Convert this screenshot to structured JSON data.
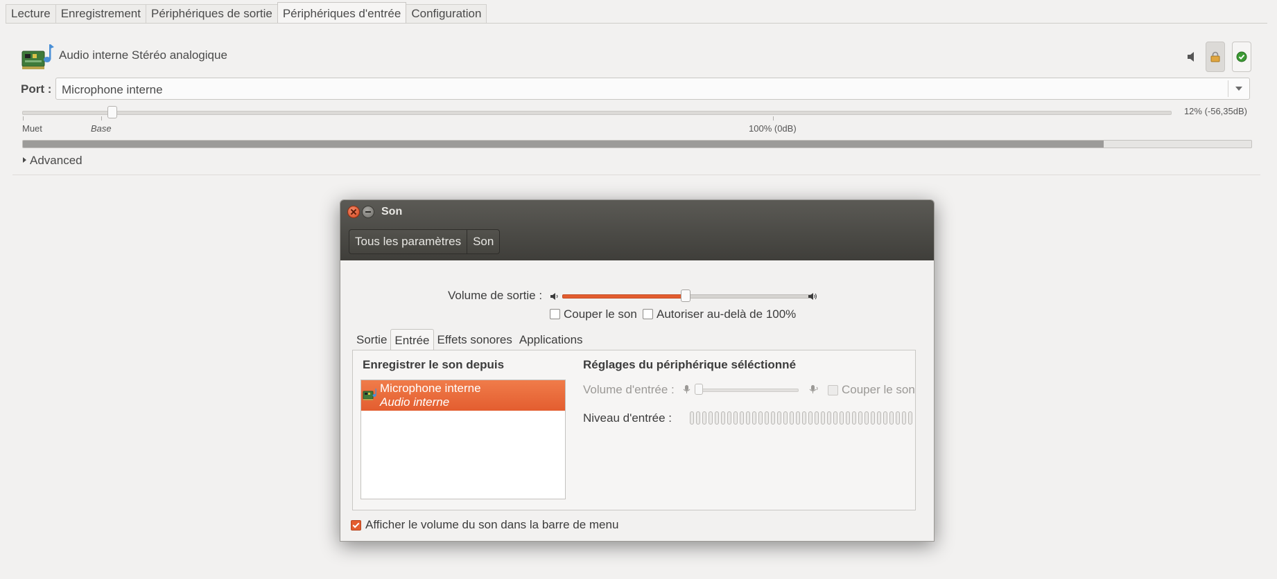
{
  "pavucontrol": {
    "tabs": [
      {
        "label": "Lecture"
      },
      {
        "label": "Enregistrement"
      },
      {
        "label": "Périphériques de sortie"
      },
      {
        "label": "Périphériques d'entrée",
        "active": true
      },
      {
        "label": "Configuration"
      }
    ],
    "device_name": "Audio interne Stéréo analogique",
    "port_label": "Port :",
    "port_value": "Microphone interne",
    "volume_percent": 12,
    "volume_readout": "12% (-56,35dB)",
    "marks": {
      "mute": "Muet",
      "base": "Base",
      "full": "100% (0dB)"
    },
    "level_fraction": 0.88,
    "advanced_label": "Advanced",
    "icons": [
      "sound-card-icon",
      "speaker-mute-icon",
      "lock-icon",
      "check-default-icon"
    ]
  },
  "dialog": {
    "title": "Son",
    "breadcrumbs": [
      "Tous les paramètres",
      "Son"
    ],
    "output_volume_label": "Volume de sortie :",
    "output_volume_fraction": 0.5,
    "mute_label": "Couper le son",
    "mute_checked": false,
    "overamp_label": "Autoriser au-delà de 100%",
    "overamp_checked": false,
    "tabs": [
      {
        "label": "Sortie"
      },
      {
        "label": "Entrée",
        "active": true
      },
      {
        "label": "Effets sonores"
      },
      {
        "label": "Applications"
      }
    ],
    "record_from_heading": "Enregistrer le son depuis",
    "devices": [
      {
        "name": "Microphone interne",
        "sub": "Audio interne",
        "selected": true
      }
    ],
    "settings_heading": "Réglages du périphérique séléctionné",
    "input_volume_label": "Volume d'entrée :",
    "input_mute_label": "Couper le son",
    "input_level_label": "Niveau d'entrée :",
    "show_volume_label": "Afficher le volume du son dans la barre de menu",
    "show_volume_checked": true
  },
  "colors": {
    "accent": "#e35d2f",
    "titlebar": "#4a4944",
    "window_bg": "#f2f1f0"
  }
}
